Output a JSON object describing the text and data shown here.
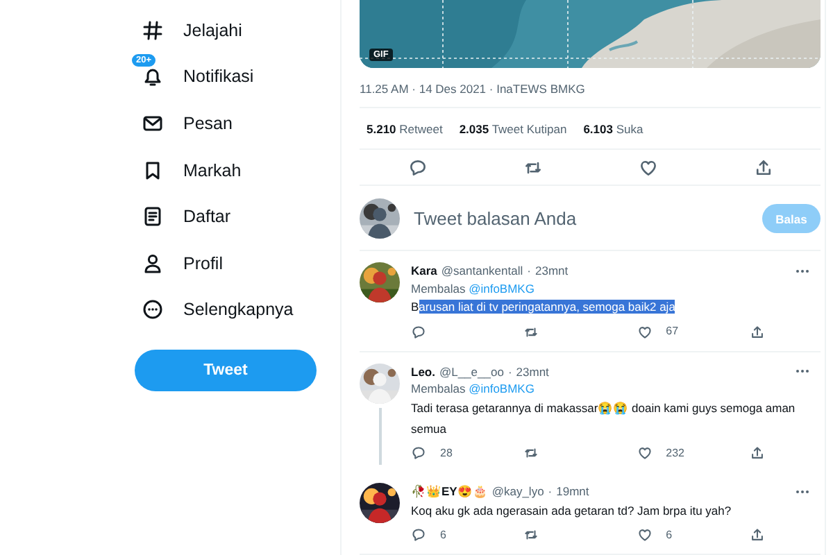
{
  "nav": [
    {
      "label": "Jelajahi"
    },
    {
      "label": "Notifikasi",
      "badge": "20+"
    },
    {
      "label": "Pesan"
    },
    {
      "label": "Markah"
    },
    {
      "label": "Daftar"
    },
    {
      "label": "Profil"
    },
    {
      "label": "Selengkapnya"
    }
  ],
  "tweet_button": "Tweet",
  "media": {
    "kind": "picture",
    "badge": "GIF"
  },
  "meta": "11.25 AM · 14 Des 2021 · InaTEWS BMKG",
  "stats": [
    "**5.210** Retweet",
    "**2.035** Tweet Kutipan",
    "**6.103** Suka"
  ],
  "actions": [
    {
      "kind": "reply"
    },
    {
      "kind": "retweet"
    },
    {
      "kind": "like"
    },
    {
      "kind": "share"
    }
  ],
  "compose": {
    "placeholder": "Tweet balasan Anda",
    "button": "Balas",
    "disabled": true
  },
  "replies": [
    {
      "name": "Kara",
      "handle": "@santankentall",
      "separator": "·",
      "time": "23mnt",
      "replying_to": "Membalas",
      "mention": "@infoBMKG",
      "thread_below": false,
      "text": [
        {
          "text": "B",
          "selected": false
        },
        {
          "text": "arusan liat di tv peringatannya, semoga baik2 aja ",
          "selected": true
        }
      ],
      "actions": [
        {
          "kind": "reply"
        },
        {
          "kind": "retweet"
        },
        {
          "kind": "like",
          "count": "67"
        },
        {
          "kind": "share"
        }
      ]
    },
    {
      "name": "Leo.",
      "handle": "@L__e__oo",
      "separator": "·",
      "time": "23mnt",
      "replying_to": "Membalas",
      "mention": "@infoBMKG",
      "thread_below": true,
      "text": [
        {
          "text": "Tadi terasa getarannya di makassar😭😭 doain kami guys semoga aman semua",
          "selected": false
        }
      ],
      "actions": [
        {
          "kind": "reply",
          "count": "28"
        },
        {
          "kind": "retweet"
        },
        {
          "kind": "like",
          "count": "232"
        },
        {
          "kind": "share"
        }
      ]
    },
    {
      "name": "🥀👑EY😍🎂",
      "handle": "@kay_lyo",
      "separator": "·",
      "time": "19mnt",
      "thread_below": false,
      "text": [
        {
          "text": "Koq aku gk ada ngerasain ada getaran td? Jam brpa itu yah?",
          "selected": false
        }
      ],
      "actions": [
        {
          "kind": "reply",
          "count": "6"
        },
        {
          "kind": "retweet"
        },
        {
          "kind": "like",
          "count": "6"
        },
        {
          "kind": "share"
        }
      ]
    }
  ]
}
